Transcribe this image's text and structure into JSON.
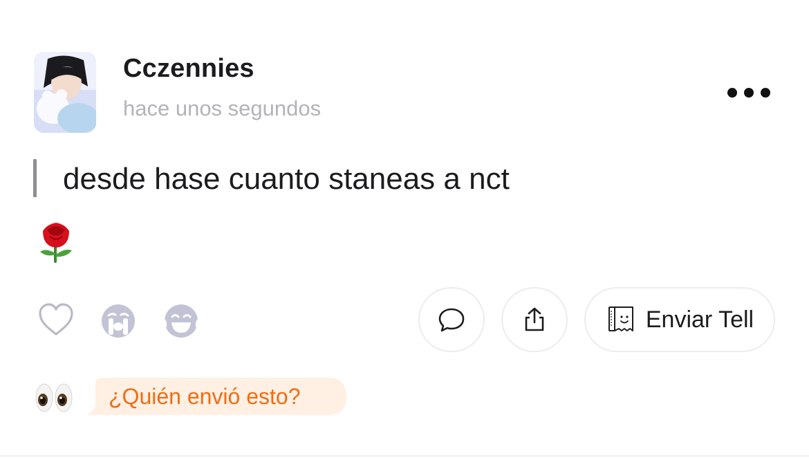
{
  "post": {
    "username": "Cczennies",
    "timestamp": "hace unos segundos",
    "message": "desde hase cuanto staneas a nct",
    "reaction_emoji": "rose"
  },
  "reactions": [
    "heart-outline-icon",
    "crying-face-icon",
    "laughing-face-icon"
  ],
  "actions": {
    "send_tell_label": "Enviar Tell"
  },
  "who_sent": {
    "label": "¿Quién envió esto?",
    "accent_color": "#f06d12",
    "bubble_color": "#fff0e3"
  }
}
